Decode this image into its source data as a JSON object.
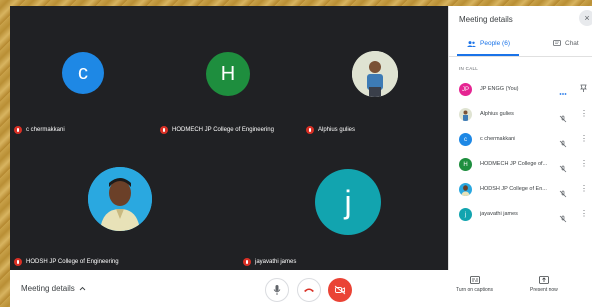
{
  "panel": {
    "title": "Meeting details",
    "close_icon": "×",
    "tabs": [
      {
        "label": "People (6)",
        "icon": "people-icon"
      },
      {
        "label": "Chat",
        "icon": "chat-icon"
      }
    ],
    "section_label": "IN CALL",
    "participants": [
      {
        "name": "JP ENGG (You)",
        "initials": "JP",
        "color": "#e52592",
        "status": "speaking"
      },
      {
        "name": "Alphius gulies",
        "initials": "",
        "color": "#8d9aa5",
        "status": "muted"
      },
      {
        "name": "c chermakkani",
        "initials": "c",
        "color": "#1e88e5",
        "status": "muted"
      },
      {
        "name": "HODMECH JP College of...",
        "initials": "H",
        "color": "#1e8e3e",
        "status": "muted"
      },
      {
        "name": "HODSH JP College of En...",
        "initials": "",
        "color": "#3b6aa0",
        "status": "muted"
      },
      {
        "name": "jayavathi james",
        "initials": "j",
        "color": "#12a4af",
        "status": "muted"
      }
    ]
  },
  "tiles": [
    {
      "name": "c chermakkani",
      "initials": "c",
      "color": "#1e88e5"
    },
    {
      "name": "HODMECH JP College of Engineering",
      "initials": "H",
      "color": "#1e8e3e"
    },
    {
      "name": "Alphius gulies",
      "initials": "",
      "color": "#e0e0d0"
    },
    {
      "name": "HODSH JP College of Engineering",
      "initials": "",
      "color": "#2aa8e0"
    },
    {
      "name": "jayavathi james",
      "initials": "j",
      "color": "#12a4af"
    }
  ],
  "bottombar": {
    "meeting_details": "Meeting details",
    "captions": "Turn on captions",
    "present": "Present now"
  },
  "colors": {
    "accent": "#1a73e8",
    "muted_red": "#d93025",
    "cam_off_red": "#ea4335"
  }
}
